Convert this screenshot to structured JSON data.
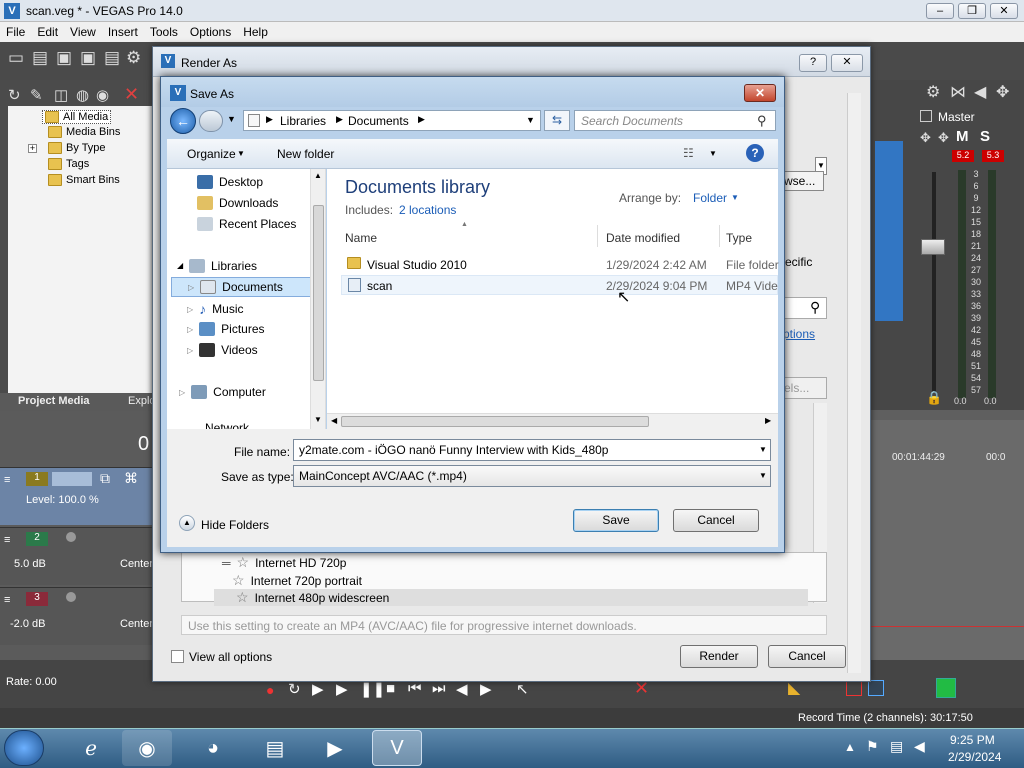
{
  "vegas": {
    "title": "scan.veg * - VEGAS Pro 14.0",
    "win_minimize": "‒",
    "win_maximize": "❐",
    "win_close": "✕",
    "menu": [
      "File",
      "Edit",
      "View",
      "Insert",
      "Tools",
      "Options",
      "Help"
    ],
    "tree": [
      "All Media",
      "Media Bins",
      "By Type",
      "Tags",
      "Smart Bins"
    ],
    "tree_expander": "+",
    "tabs": [
      "Project Media",
      "Explo"
    ],
    "time_partial": "0",
    "track1_level": "Level: 100.0 %",
    "track1_number": "1",
    "track2_number": "2",
    "track2_db": "5.0 dB",
    "track2_pan": "Center",
    "track3_number": "3",
    "track3_db": "-2.0 dB",
    "track3_pan": "Center",
    "master_label": "Master",
    "master_peak_left": "5.2",
    "master_peak_right": "5.3",
    "master_scale": [
      "3",
      "6",
      "9",
      "12",
      "15",
      "18",
      "21",
      "24",
      "27",
      "30",
      "33",
      "36",
      "39",
      "42",
      "45",
      "48",
      "51",
      "54",
      "57"
    ],
    "master_readout_left": "0.0",
    "master_readout_right": "0.0",
    "timeline_time": "00:01:44:29",
    "timeline_time2": "00:0",
    "rate": "Rate: 0.00",
    "record_time": "Record Time (2 channels): 30:17:50"
  },
  "render_as": {
    "title": "Render As",
    "help_btn": "?",
    "close_btn": "✕",
    "browse_partial": "wse...",
    "specific_partial": "ecific",
    "options_partial": "ptions",
    "els_partial": "els...",
    "templates": [
      "Internet HD 720p",
      "Internet 720p portrait",
      "Internet 480p widescreen"
    ],
    "description": "Use this setting to create an MP4 (AVC/AAC) file for progressive internet downloads.",
    "view_all_options": "View all options",
    "render_btn": "Render",
    "cancel_btn": "Cancel"
  },
  "save_as": {
    "title": "Save As",
    "close_btn": "✕",
    "breadcrumb": [
      "Libraries",
      "Documents"
    ],
    "search_placeholder": "Search Documents",
    "organize": "Organize",
    "new_folder": "New folder",
    "help_btn": "?",
    "nav": {
      "favorites": [
        "Desktop",
        "Downloads",
        "Recent Places"
      ],
      "libraries": "Libraries",
      "library_items": [
        "Documents",
        "Music",
        "Pictures",
        "Videos"
      ],
      "computer": "Computer",
      "network_partial": "Network"
    },
    "library_title": "Documents library",
    "includes_label": "Includes:",
    "includes_link": "2 locations",
    "arrange_label": "Arrange by:",
    "arrange_value": "Folder",
    "columns": [
      "Name",
      "Date modified",
      "Type"
    ],
    "files": [
      {
        "name": "Visual Studio 2010",
        "date": "1/29/2024 2:42 AM",
        "type": "File folder"
      },
      {
        "name": "scan",
        "date": "2/29/2024 9:04 PM",
        "type": "MP4 Vide"
      }
    ],
    "file_name_label": "File name:",
    "file_name_value": "y2mate.com - iÖGO nanö Funny Interview with Kids_480p",
    "save_type_label": "Save as type:",
    "save_type_value": "MainConcept AVC/AAC (*.mp4)",
    "hide_folders": "Hide Folders",
    "save_btn": "Save",
    "cancel_btn": "Cancel"
  },
  "taskbar": {
    "time": "9:25 PM",
    "date": "2/29/2024"
  }
}
